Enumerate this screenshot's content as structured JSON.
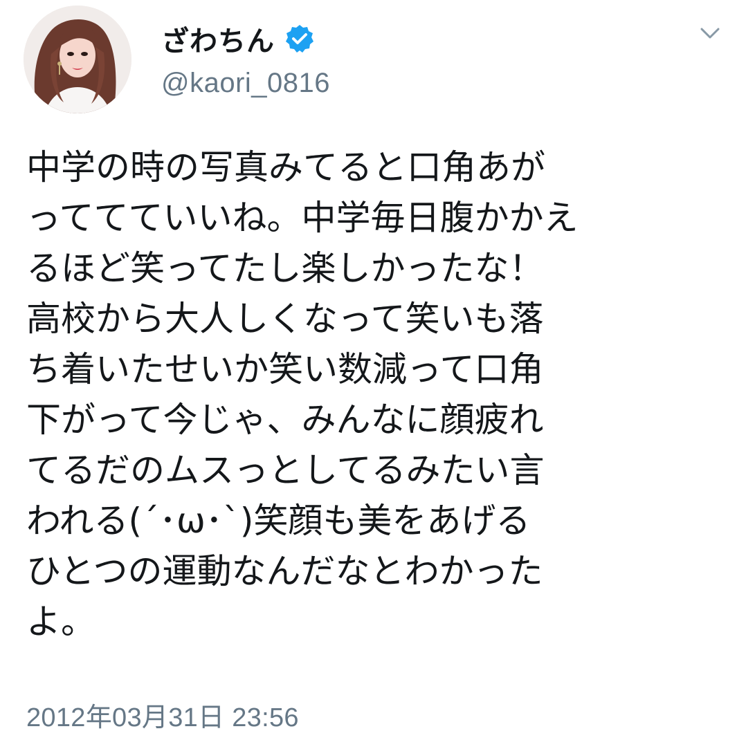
{
  "user": {
    "display_name": "ざわちん",
    "handle": "@kaori_0816",
    "avatar_icon": "profile-photo",
    "verified_icon": "verified-badge-icon",
    "verified_color": "#1da1f2"
  },
  "menu": {
    "icon": "chevron-down-icon"
  },
  "tweet": {
    "text": "中学の時の写真みてると口角あが\nっててていいね。中学毎日腹かかえ\nるほど笑ってたし楽しかったな！\n高校から大人しくなって笑いも落\nち着いたせいか笑い数減って口角\n下がって今じゃ、みんなに顔疲れ\nてるだのムスっとしてるみたい言\nわれる(´･ω･`)笑顔も美をあげる\nひとつの運動なんだなとわかった\nよ。",
    "timestamp": "2012年03月31日 23:56"
  },
  "colors": {
    "text": "#14171a",
    "secondary": "#657786",
    "accent": "#1da1f2"
  }
}
